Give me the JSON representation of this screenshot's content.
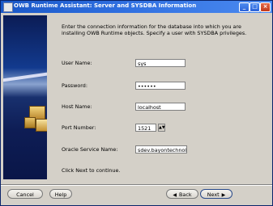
{
  "window": {
    "title": "OWB Runtime Assistant: Server and SYSDBA Information",
    "controls": {
      "minimize": "_",
      "maximize": "□",
      "close": "×"
    }
  },
  "instructions": "Enter the connection information for the database into which you are installing OWB Runtime objects.  Specify a user with SYSDBA privileges.",
  "form": {
    "user_name": {
      "label": "User Name:",
      "value": "sys"
    },
    "password": {
      "label": "Password:",
      "value": "••••••"
    },
    "host_name": {
      "label": "Host Name:",
      "value": "localhost"
    },
    "port_number": {
      "label": "Port Number:",
      "value": "1521"
    },
    "oracle_service_name": {
      "label": "Oracle Service Name:",
      "value": "sdev.bayontechnologies.com"
    }
  },
  "hint": "Click Next to continue.",
  "buttons": {
    "cancel": "Cancel",
    "help": "Help",
    "back": "Back",
    "next": "Next",
    "back_arrow": "◀",
    "next_arrow": "▶"
  },
  "icons": {
    "title": "app-window-icon",
    "banner": "database-cubes-icon",
    "spinner": "spinner-arrows-icon"
  }
}
